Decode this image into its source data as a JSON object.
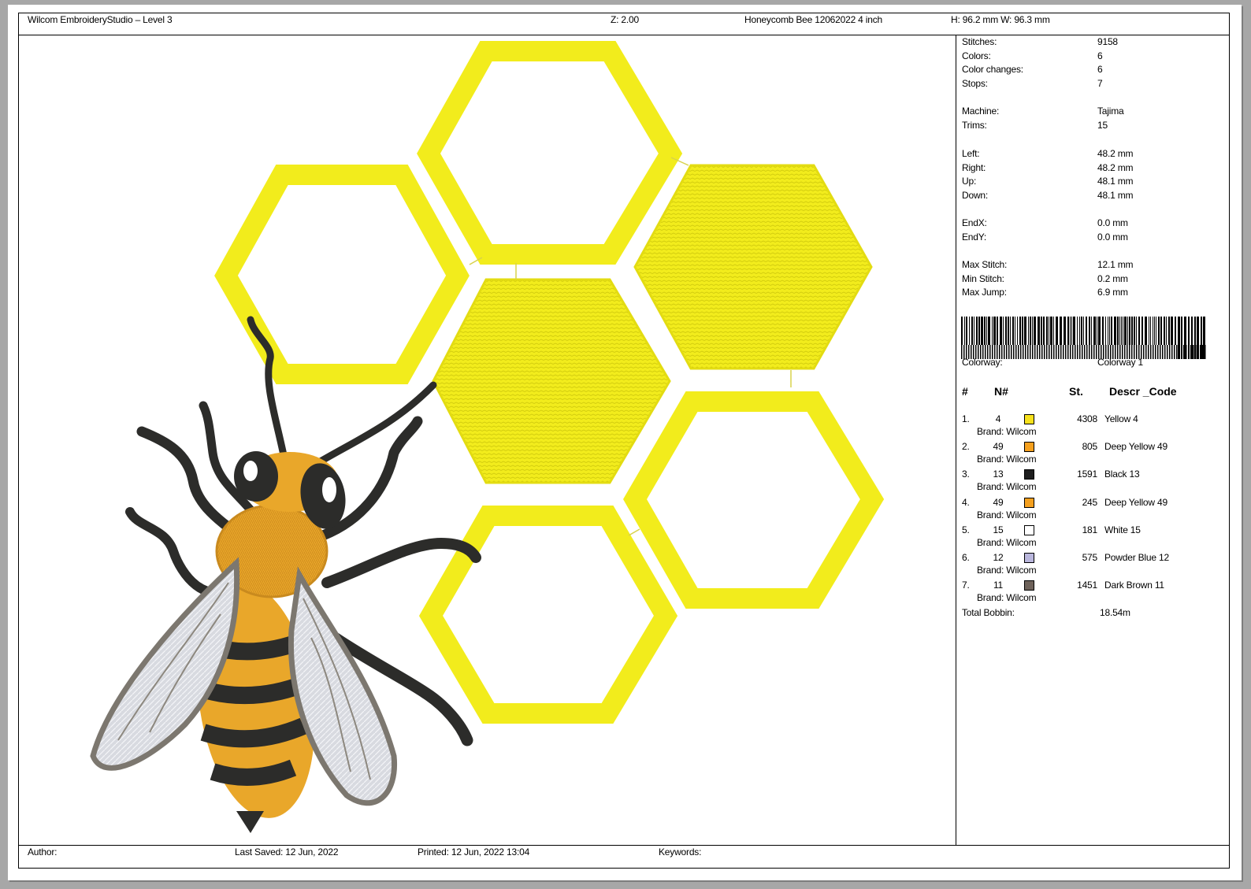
{
  "header": {
    "app_title": "Wilcom EmbroideryStudio – Level 3",
    "zoom": "Z: 2.00",
    "design_name": "Honeycomb Bee 12062022 4  inch",
    "dimensions": "H: 96.2 mm   W: 96.3 mm"
  },
  "stats": [
    {
      "label": "Stitches:",
      "value": "9158"
    },
    {
      "label": "Colors:",
      "value": "6"
    },
    {
      "label": "Color changes:",
      "value": "6"
    },
    {
      "label": "Stops:",
      "value": "7"
    },
    {
      "label": "Machine:",
      "value": "Tajima"
    },
    {
      "label": "Trims:",
      "value": "15"
    },
    {
      "label": "Left:",
      "value": "48.2 mm"
    },
    {
      "label": "Right:",
      "value": "48.2 mm"
    },
    {
      "label": "Up:",
      "value": "48.1 mm"
    },
    {
      "label": "Down:",
      "value": "48.1 mm"
    },
    {
      "label": "EndX:",
      "value": "0.0 mm"
    },
    {
      "label": "EndY:",
      "value": "0.0 mm"
    },
    {
      "label": "Max Stitch:",
      "value": "12.1 mm"
    },
    {
      "label": "Min Stitch:",
      "value": "0.2 mm"
    },
    {
      "label": "Max Jump:",
      "value": "6.9 mm"
    }
  ],
  "colorway": {
    "label": "Colorway:",
    "value": "Colorway 1"
  },
  "color_table": {
    "headers": {
      "index": "#",
      "number": "N#",
      "stitches": "St.",
      "description": "Descr _Code"
    },
    "rows": [
      {
        "index": "1.",
        "number": "4",
        "color": "#f7e11c",
        "stitches": "4308",
        "description": "Yellow 4",
        "brand": "Brand: Wilcom"
      },
      {
        "index": "2.",
        "number": "49",
        "color": "#f5a01e",
        "stitches": "805",
        "description": "Deep Yellow 49",
        "brand": "Brand: Wilcom"
      },
      {
        "index": "3.",
        "number": "13",
        "color": "#1e1e1e",
        "stitches": "1591",
        "description": "Black 13",
        "brand": "Brand: Wilcom"
      },
      {
        "index": "4.",
        "number": "49",
        "color": "#f5a01e",
        "stitches": "245",
        "description": "Deep Yellow 49",
        "brand": "Brand: Wilcom"
      },
      {
        "index": "5.",
        "number": "15",
        "color": "#ffffff",
        "stitches": "181",
        "description": "White 15",
        "brand": "Brand: Wilcom"
      },
      {
        "index": "6.",
        "number": "12",
        "color": "#b9b6dc",
        "stitches": "575",
        "description": "Powder Blue 12",
        "brand": "Brand: Wilcom"
      },
      {
        "index": "7.",
        "number": "11",
        "color": "#6e625a",
        "stitches": "1451",
        "description": "Dark Brown 11",
        "brand": "Brand: Wilcom"
      }
    ],
    "total_bobbin_label": "Total Bobbin:",
    "total_bobbin_value": "18.54m"
  },
  "footer": {
    "author": "Author:",
    "last_saved": "Last Saved: 12 Jun, 2022",
    "printed": "Printed: 12 Jun, 2022 13:04",
    "keywords": "Keywords:"
  },
  "design_colors": {
    "honeycomb_yellow": "#f2ec1c",
    "bee_orange": "#e9a72a",
    "bee_black": "#2c2c2a",
    "wing_silver": "#d8dae0",
    "wing_outline": "#7c776f"
  }
}
